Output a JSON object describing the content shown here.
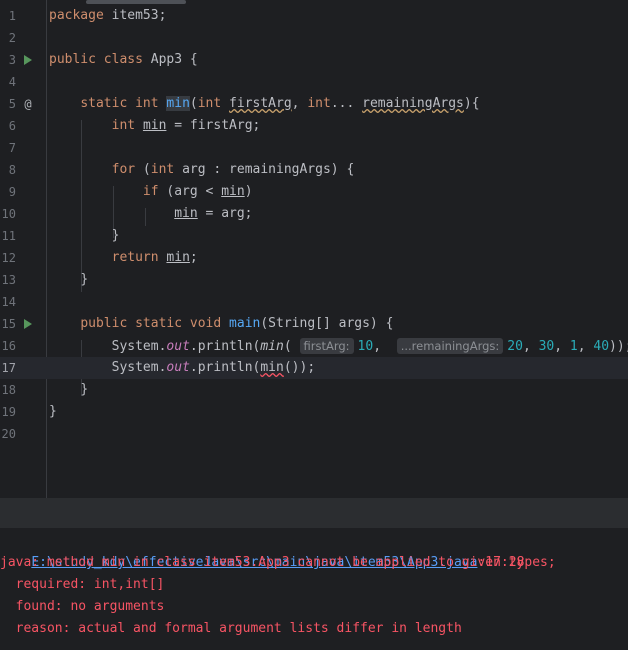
{
  "editor": {
    "line_numbers": [
      "1",
      "2",
      "3",
      "4",
      "5",
      "6",
      "7",
      "8",
      "9",
      "10",
      "11",
      "12",
      "13",
      "14",
      "15",
      "16",
      "17",
      "18",
      "19",
      "20"
    ],
    "kw": {
      "package": "package",
      "public": "public",
      "class": "class",
      "static": "static",
      "int": "int",
      "for": "for",
      "if": "if",
      "return": "return",
      "void": "void"
    },
    "tokens": {
      "pkg_name": " item53;",
      "class_name": " App3 {",
      "min_fn": "min",
      "first_arg": "firstArg",
      "remaining_args": "remainingArgs",
      "ellipsis": "...",
      "open_brace": "{",
      "close_brace": "}",
      "min_var": "min",
      "assign_first": " = firstArg;",
      "arg_var": "arg",
      "arg_colon": " : remainingArgs) {",
      "if_cond_open": " (arg < ",
      "close_paren": ")",
      "assign_arg": " = arg;",
      "semicolon": ";",
      "main_fn": "main",
      "main_sig": "(String[] args) {",
      "system": "System.",
      "out": "out",
      "println": ".println(",
      "hint_first": "firstArg:",
      "hint_remaining": "...remainingArgs:",
      "n10": "10",
      "n20": "20",
      "n30": "30",
      "n1": "1",
      "n40": "40",
      "end_call": "));",
      "min_plain": "min"
    }
  },
  "console": {
    "path": "E:\\study_kdy\\effectiveJava\\src\\main\\java\\item53\\App3.java",
    "location": ":17:28",
    "error_line": "java: method min in class item53.App3 cannot be applied to given types;",
    "required": "  required: int,int[]",
    "found": "  found: no arguments",
    "reason": "  reason: actual and formal argument lists differ in length"
  },
  "colors": {
    "background": "#1e1f22",
    "keyword": "#cf8e6d",
    "function": "#56a8f5",
    "number": "#2aacb8",
    "error": "#f75464",
    "link": "#589df6"
  }
}
